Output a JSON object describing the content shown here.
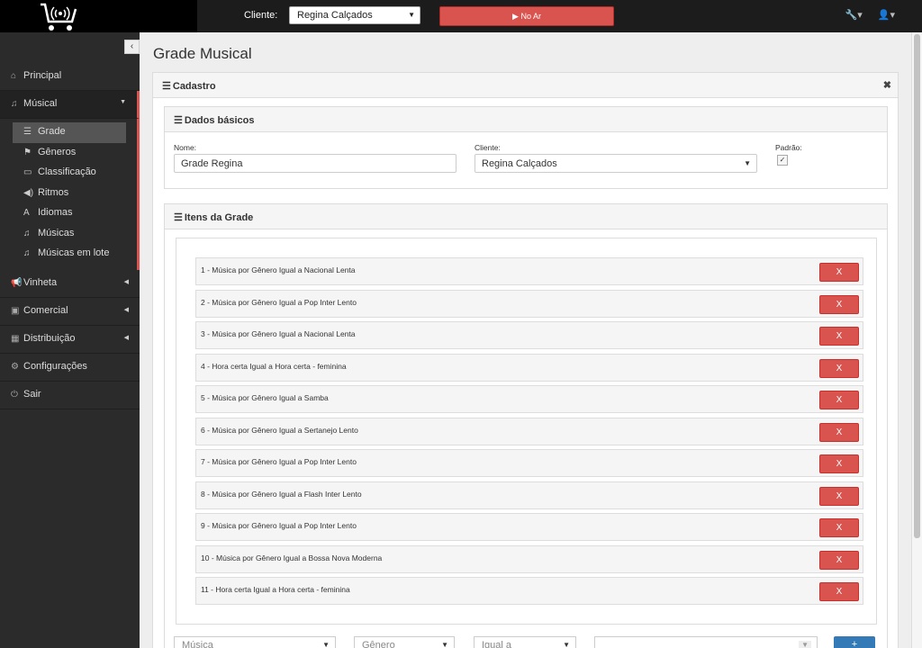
{
  "topbar": {
    "client_label": "Cliente:",
    "client_value": "Regina Calçados",
    "onair_label": "▶ No Ar"
  },
  "sidebar": {
    "collapse": "‹",
    "items": [
      {
        "label": "Principal",
        "icon": "home-icon"
      },
      {
        "label": "Músical",
        "icon": "music-icon"
      },
      {
        "label": "Vinheta",
        "icon": "megaphone-icon"
      },
      {
        "label": "Comercial",
        "icon": "money-icon"
      },
      {
        "label": "Distribuição",
        "icon": "calendar-icon"
      },
      {
        "label": "Configurações",
        "icon": "gears-icon"
      },
      {
        "label": "Sair",
        "icon": "power-icon"
      }
    ],
    "sub_items": [
      {
        "label": "Grade",
        "icon": "list-icon"
      },
      {
        "label": "Gêneros",
        "icon": "flag-icon"
      },
      {
        "label": "Classificação",
        "icon": "card-icon"
      },
      {
        "label": "Ritmos",
        "icon": "volume-icon"
      },
      {
        "label": "Idiomas",
        "icon": "font-icon"
      },
      {
        "label": "Músicas",
        "icon": "music-icon"
      },
      {
        "label": "Músicas em lote",
        "icon": "music-icon"
      }
    ]
  },
  "main": {
    "title": "Grade Musical",
    "cadastro_title": "Cadastro",
    "dados_title": "Dados básicos",
    "nome_label": "Nome:",
    "nome_value": "Grade Regina",
    "cliente_label": "Cliente:",
    "cliente_value": "Regina Calçados",
    "padrao_label": "Padrão:",
    "padrao_checked": true,
    "itens_title": "Itens da Grade",
    "delete_label": "X",
    "items": [
      "1 - Música por Gênero Igual a Nacional Lenta",
      "2 - Música por Gênero Igual a Pop Inter Lento",
      "3 - Música por Gênero Igual a Nacional Lenta",
      "4 - Hora certa Igual a Hora certa - feminina",
      "5 - Música por Gênero Igual a Samba",
      "6 - Música por Gênero Igual a Sertanejo Lento",
      "7 - Música por Gênero Igual a Pop Inter Lento",
      "8 - Música por Gênero Igual a Flash Inter Lento",
      "9 - Música por Gênero Igual a Pop Inter Lento",
      "10 - Música por Gênero Igual a Bossa Nova Moderna",
      "11 - Hora certa Igual a Hora certa - feminina"
    ],
    "bottom": {
      "type_value": "Música",
      "field_value": "Gênero",
      "op_value": "Igual a",
      "add_label": "+"
    }
  }
}
